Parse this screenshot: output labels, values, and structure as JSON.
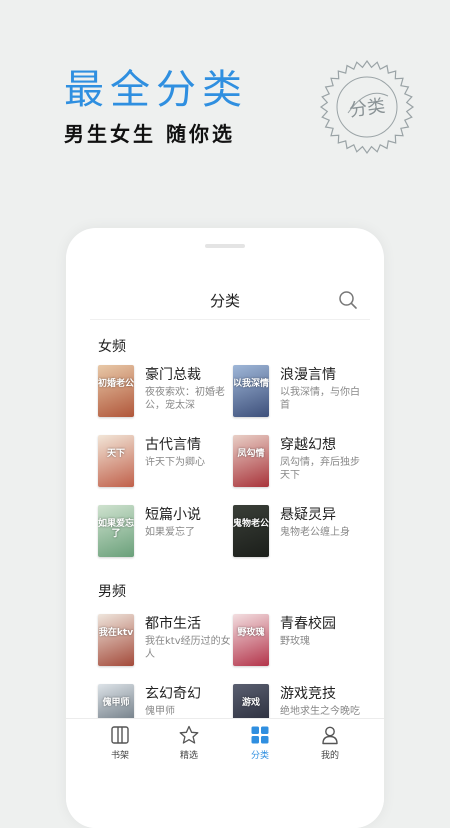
{
  "hero": {
    "title": "最全分类",
    "subtitle": "男生女生 随你选",
    "stamp_text": "分类"
  },
  "header": {
    "title": "分类"
  },
  "sections": [
    {
      "title": "女频",
      "items": [
        {
          "name": "豪门总裁",
          "desc": "夜夜索欢：初婚老公，宠太深",
          "cover_text": "初婚老公"
        },
        {
          "name": "浪漫言情",
          "desc": "以我深情，与你白首",
          "cover_text": "以我深情"
        },
        {
          "name": "古代言情",
          "desc": "许天下为卿心",
          "cover_text": "天下"
        },
        {
          "name": "穿越幻想",
          "desc": "凤勾情，弃后独步天下",
          "cover_text": "凤勾情"
        },
        {
          "name": "短篇小说",
          "desc": "如果爱忘了",
          "cover_text": "如果爱忘了"
        },
        {
          "name": "悬疑灵异",
          "desc": "鬼物老公缠上身",
          "cover_text": "鬼物老公"
        }
      ]
    },
    {
      "title": "男频",
      "items": [
        {
          "name": "都市生活",
          "desc": "我在ktv经历过的女人",
          "cover_text": "我在ktv"
        },
        {
          "name": "青春校园",
          "desc": "野玫瑰",
          "cover_text": "野玫瑰"
        },
        {
          "name": "玄幻奇幻",
          "desc": "傀甲师",
          "cover_text": "傀甲师"
        },
        {
          "name": "游戏竞技",
          "desc": "绝地求生之今晚吃",
          "cover_text": "游戏"
        }
      ]
    }
  ],
  "tabs": [
    {
      "label": "书架",
      "icon": "bookshelf-icon"
    },
    {
      "label": "精选",
      "icon": "star-icon"
    },
    {
      "label": "分类",
      "icon": "grid-icon",
      "active": true
    },
    {
      "label": "我的",
      "icon": "user-icon"
    }
  ],
  "colors": {
    "accent": "#2f8fe0",
    "background": "#eef0ef"
  }
}
